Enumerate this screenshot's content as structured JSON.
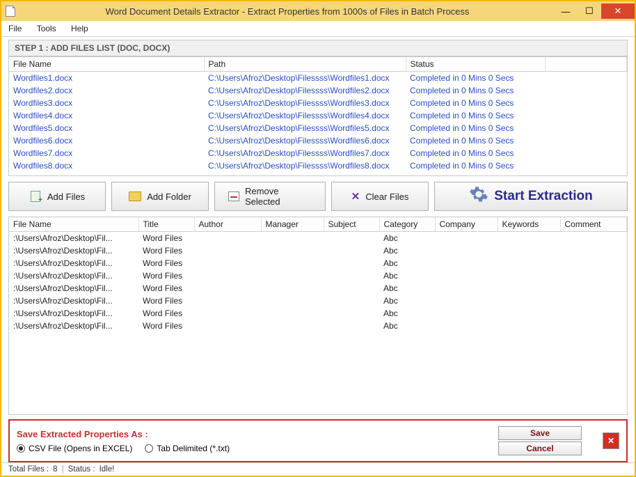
{
  "window": {
    "title": "Word Document Details Extractor - Extract Properties from 1000s of Files in Batch Process"
  },
  "menu": {
    "file": "File",
    "tools": "Tools",
    "help": "Help"
  },
  "step_header": "STEP 1 : ADD FILES LIST (DOC, DOCX)",
  "table1": {
    "cols": {
      "filename": "File Name",
      "path": "Path",
      "status": "Status"
    },
    "rows": [
      {
        "filename": "Wordfiles1.docx",
        "path": "C:\\Users\\Afroz\\Desktop\\Filessss\\Wordfiles1.docx",
        "status": "Completed in 0 Mins 0 Secs"
      },
      {
        "filename": "Wordfiles2.docx",
        "path": "C:\\Users\\Afroz\\Desktop\\Filessss\\Wordfiles2.docx",
        "status": "Completed in 0 Mins 0 Secs"
      },
      {
        "filename": "Wordfiles3.docx",
        "path": "C:\\Users\\Afroz\\Desktop\\Filessss\\Wordfiles3.docx",
        "status": "Completed in 0 Mins 0 Secs"
      },
      {
        "filename": "Wordfiles4.docx",
        "path": "C:\\Users\\Afroz\\Desktop\\Filessss\\Wordfiles4.docx",
        "status": "Completed in 0 Mins 0 Secs"
      },
      {
        "filename": "Wordfiles5.docx",
        "path": "C:\\Users\\Afroz\\Desktop\\Filessss\\Wordfiles5.docx",
        "status": "Completed in 0 Mins 0 Secs"
      },
      {
        "filename": "Wordfiles6.docx",
        "path": "C:\\Users\\Afroz\\Desktop\\Filessss\\Wordfiles6.docx",
        "status": "Completed in 0 Mins 0 Secs"
      },
      {
        "filename": "Wordfiles7.docx",
        "path": "C:\\Users\\Afroz\\Desktop\\Filessss\\Wordfiles7.docx",
        "status": "Completed in 0 Mins 0 Secs"
      },
      {
        "filename": "Wordfiles8.docx",
        "path": "C:\\Users\\Afroz\\Desktop\\Filessss\\Wordfiles8.docx",
        "status": "Completed in 0 Mins 0 Secs"
      }
    ]
  },
  "toolbar": {
    "add_files": "Add Files",
    "add_folder": "Add Folder",
    "remove_selected": "Remove Selected",
    "clear_files": "Clear Files",
    "start_extraction": "Start Extraction"
  },
  "table2": {
    "cols": {
      "filename": "File Name",
      "title": "Title",
      "author": "Author",
      "manager": "Manager",
      "subject": "Subject",
      "category": "Category",
      "company": "Company",
      "keywords": "Keywords",
      "comment": "Comment"
    },
    "rows": [
      {
        "filename": ":\\Users\\Afroz\\Desktop\\Fil...",
        "title": "Word Files",
        "author": "",
        "manager": "",
        "subject": "",
        "category": "Abc",
        "company": "",
        "keywords": "",
        "comment": ""
      },
      {
        "filename": ":\\Users\\Afroz\\Desktop\\Fil...",
        "title": "Word Files",
        "author": "",
        "manager": "",
        "subject": "",
        "category": "Abc",
        "company": "",
        "keywords": "",
        "comment": ""
      },
      {
        "filename": ":\\Users\\Afroz\\Desktop\\Fil...",
        "title": "Word Files",
        "author": "",
        "manager": "",
        "subject": "",
        "category": "Abc",
        "company": "",
        "keywords": "",
        "comment": ""
      },
      {
        "filename": ":\\Users\\Afroz\\Desktop\\Fil...",
        "title": "Word Files",
        "author": "",
        "manager": "",
        "subject": "",
        "category": "Abc",
        "company": "",
        "keywords": "",
        "comment": ""
      },
      {
        "filename": ":\\Users\\Afroz\\Desktop\\Fil...",
        "title": "Word Files",
        "author": "",
        "manager": "",
        "subject": "",
        "category": "Abc",
        "company": "",
        "keywords": "",
        "comment": ""
      },
      {
        "filename": ":\\Users\\Afroz\\Desktop\\Fil...",
        "title": "Word Files",
        "author": "",
        "manager": "",
        "subject": "",
        "category": "Abc",
        "company": "",
        "keywords": "",
        "comment": ""
      },
      {
        "filename": ":\\Users\\Afroz\\Desktop\\Fil...",
        "title": "Word Files",
        "author": "",
        "manager": "",
        "subject": "",
        "category": "Abc",
        "company": "",
        "keywords": "",
        "comment": ""
      },
      {
        "filename": ":\\Users\\Afroz\\Desktop\\Fil...",
        "title": "Word Files",
        "author": "",
        "manager": "",
        "subject": "",
        "category": "Abc",
        "company": "",
        "keywords": "",
        "comment": ""
      }
    ]
  },
  "save_panel": {
    "label": "Save Extracted Properties As :",
    "opt_csv": "CSV File (Opens in EXCEL)",
    "opt_tab": "Tab Delimited (*.txt)",
    "save": "Save",
    "cancel": "Cancel"
  },
  "statusbar": {
    "total_files_label": "Total Files :",
    "total_files_value": "8",
    "status_label": "Status :",
    "status_value": "Idle!"
  }
}
